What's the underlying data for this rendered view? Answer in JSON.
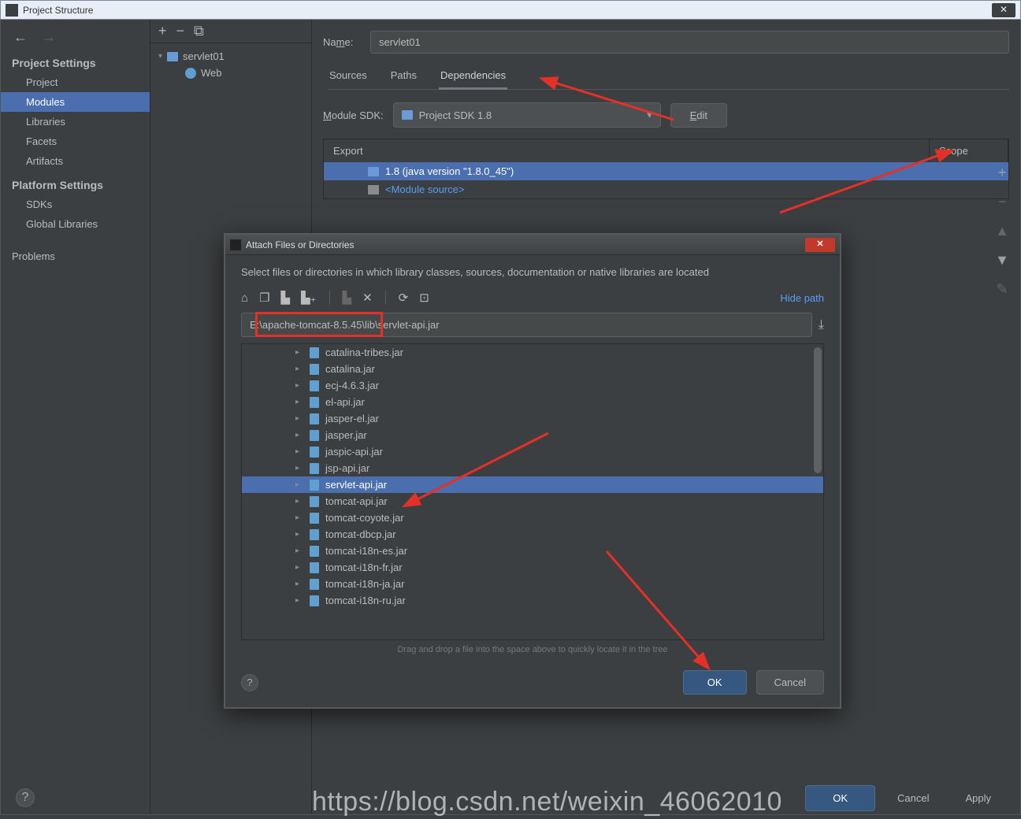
{
  "window": {
    "title": "Project Structure"
  },
  "sidebar": {
    "section1": "Project Settings",
    "items1": {
      "project": "Project",
      "modules": "Modules",
      "libraries": "Libraries",
      "facets": "Facets",
      "artifacts": "Artifacts"
    },
    "section2": "Platform Settings",
    "items2": {
      "sdks": "SDKs",
      "globallibs": "Global Libraries"
    },
    "problems": "Problems"
  },
  "tree": {
    "module": "servlet01",
    "child": "Web"
  },
  "main": {
    "name_label": "Name:",
    "name_value": "servlet01",
    "tabs": {
      "sources": "Sources",
      "paths": "Paths",
      "deps": "Dependencies"
    },
    "sdk_label": "Module SDK:",
    "sdk_value": "Project SDK 1.8",
    "edit": "Edit",
    "dep_head": {
      "export": "Export",
      "scope": "Scope"
    },
    "dep_rows": {
      "r1": "1.8 (java version \"1.8.0_45\")",
      "r2": "<Module source>"
    }
  },
  "dialog": {
    "title": "Attach Files or Directories",
    "subtitle": "Select files or directories in which library classes, sources, documentation or native libraries are located",
    "hide": "Hide path",
    "path": "E:\\apache-tomcat-8.5.45\\lib\\servlet-api.jar",
    "files": [
      "catalina-tribes.jar",
      "catalina.jar",
      "ecj-4.6.3.jar",
      "el-api.jar",
      "jasper-el.jar",
      "jasper.jar",
      "jaspic-api.jar",
      "jsp-api.jar",
      "servlet-api.jar",
      "tomcat-api.jar",
      "tomcat-coyote.jar",
      "tomcat-dbcp.jar",
      "tomcat-i18n-es.jar",
      "tomcat-i18n-fr.jar",
      "tomcat-i18n-ja.jar",
      "tomcat-i18n-ru.jar"
    ],
    "selected_index": 8,
    "hint": "Drag and drop a file into the space above to quickly locate it in the tree",
    "ok": "OK",
    "cancel": "Cancel"
  },
  "bottom": {
    "ok": "OK",
    "cancel": "Cancel",
    "apply": "Apply"
  },
  "watermark": "https://blog.csdn.net/weixin_46062010"
}
